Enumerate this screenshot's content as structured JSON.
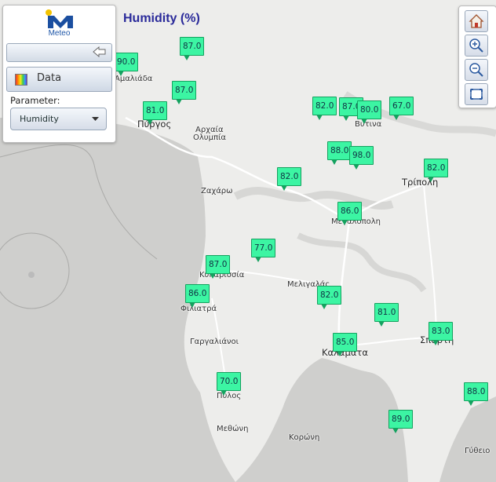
{
  "title": "Humidity (%)",
  "panel": {
    "logo_text": "Meteo",
    "data_label": "Data",
    "parameter_label": "Parameter:",
    "parameter_value": "Humidity"
  },
  "colors": {
    "station_fill": "#3cf5a3",
    "station_border": "#14a25f",
    "title": "#2a2a9a"
  },
  "toolbar": [
    "home-icon",
    "zoom-in-icon",
    "zoom-out-icon",
    "zoom-extent-icon"
  ],
  "places": [
    {
      "name": "Πύργος"
    },
    {
      "name": "Αρχαία"
    },
    {
      "name": "Ολυμπία"
    },
    {
      "name": "Βυτινα"
    },
    {
      "name": "Τρίπολη"
    },
    {
      "name": "Ζαχάρω"
    },
    {
      "name": "Μεγαλόπολη"
    },
    {
      "name": "Κυπαρισσία"
    },
    {
      "name": "Μελιγαλάς"
    },
    {
      "name": "Φιλιατρά"
    },
    {
      "name": "Γαργαλιάνοι"
    },
    {
      "name": "Καλαμάτα"
    },
    {
      "name": "Σπάρτη"
    },
    {
      "name": "Πύλος"
    },
    {
      "name": "Μεθώνη"
    },
    {
      "name": "Κορώνη"
    },
    {
      "name": "Γύθειο"
    },
    {
      "name": "Αμαλιάδα"
    }
  ],
  "stations": [
    {
      "value": "90.0"
    },
    {
      "value": "87.0"
    },
    {
      "value": "87.0"
    },
    {
      "value": "81.0"
    },
    {
      "value": "82.0"
    },
    {
      "value": "87.0"
    },
    {
      "value": "80.0"
    },
    {
      "value": "67.0"
    },
    {
      "value": "88.0"
    },
    {
      "value": "98.0"
    },
    {
      "value": "82.0"
    },
    {
      "value": "82.0"
    },
    {
      "value": "86.0"
    },
    {
      "value": "77.0"
    },
    {
      "value": "87.0"
    },
    {
      "value": "86.0"
    },
    {
      "value": "82.0"
    },
    {
      "value": "81.0"
    },
    {
      "value": "83.0"
    },
    {
      "value": "85.0"
    },
    {
      "value": "70.0"
    },
    {
      "value": "88.0"
    },
    {
      "value": "89.0"
    }
  ]
}
